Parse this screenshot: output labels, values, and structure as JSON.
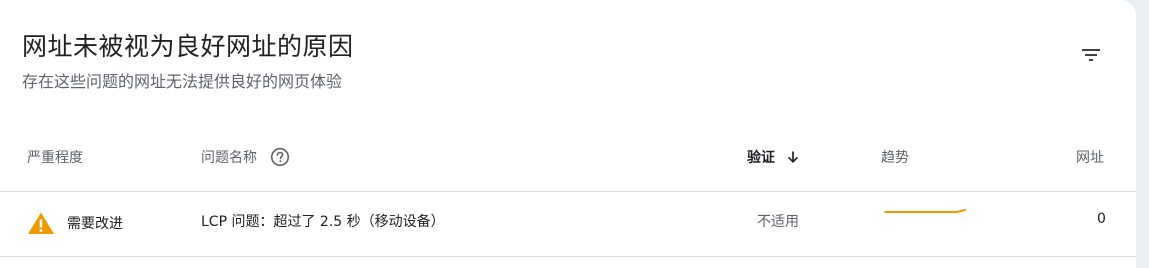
{
  "header": {
    "title": "网址未被视为良好网址的原因",
    "subtitle": "存在这些问题的网址无法提供良好的网页体验",
    "filter_icon": "filter-list-icon"
  },
  "table": {
    "columns": {
      "severity": "严重程度",
      "issue_name": "问题名称",
      "validation": "验证",
      "trend": "趋势",
      "urls": "网址"
    },
    "sort": {
      "column": "validation",
      "direction": "descending",
      "icon": "arrow-down-icon"
    },
    "help_icon": "help-circle-icon",
    "rows": [
      {
        "severity": "需要改进",
        "severity_icon": "warning-icon",
        "severity_color": "#f29900",
        "issue_name": "LCP 问题：超过了 2.5 秒（移动设备）",
        "validation": "不适用",
        "trend_color": "#f29900",
        "urls": "0"
      }
    ]
  },
  "colors": {
    "text_primary": "#202124",
    "text_secondary": "#5f6368",
    "divider": "#dadce0",
    "warning": "#f29900"
  }
}
